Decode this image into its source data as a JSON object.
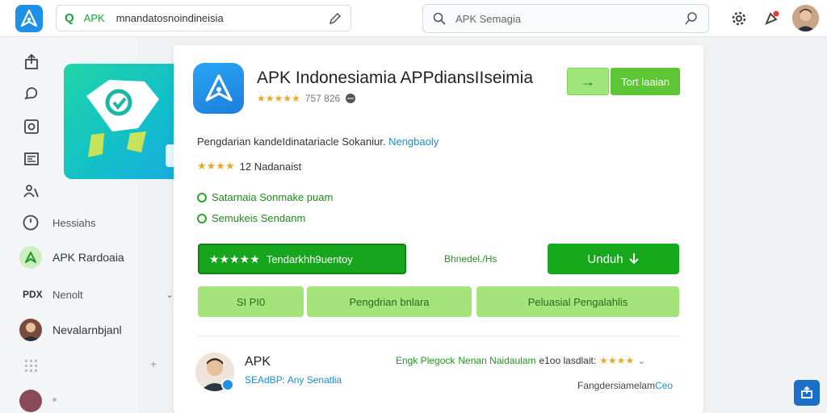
{
  "topbar": {
    "addr_prefix": "APK",
    "addr_url": "mnandatosnoindineisia",
    "search_placeholder": "APK Semagia"
  },
  "sidebar": {
    "items": [
      {
        "label": "Hessiahs",
        "icon": "clock-icon"
      },
      {
        "label": "APK Rardoaia",
        "icon": "apk-icon"
      },
      {
        "label": "Nenolt",
        "icon": "pdf-icon"
      },
      {
        "label": "Nevalarnbjanl",
        "icon": "user-avatar"
      }
    ],
    "pdf_tag": "PDX"
  },
  "card": {
    "title": "APK Indonesiamia APPdiansIIseimia",
    "rating_stars": "★★★★★",
    "rating_count": "757 826",
    "top_button": "Tort laaian",
    "arrow_button": "→",
    "desc": "Pengdarian kandeIdinatariacle Sokaniur.",
    "desc_link": "Nengbaoly",
    "stars2": "★★★★",
    "rating2": "12 Nadanaist",
    "features": [
      "Satarnaia Sonmake puam",
      "Semukeis Sendanm"
    ],
    "rate_button_stars": "★★★★★",
    "rate_button_text": "Tendarkhh9uentoy",
    "middle_link": "Bhnedel./Hs",
    "download_button": "Unduh",
    "light_buttons": [
      "SI PI0",
      "Pengdrian bnlara",
      "Peluasial Pengalahlis"
    ]
  },
  "developer": {
    "name": "APK",
    "sub": "SEAdBP: Any Senatlia",
    "right_green": "Engk Plegock",
    "right_text": "Nenan Naidaulam",
    "right_count": "e1oo lasdlait:",
    "right_stars": "★★★★",
    "footer": "Fangdersiamelam",
    "footer_link": "Ceo"
  },
  "colors": {
    "accent_green": "#15a81b",
    "light_green": "#a4e47a",
    "brand_blue": "#1e90e8"
  }
}
